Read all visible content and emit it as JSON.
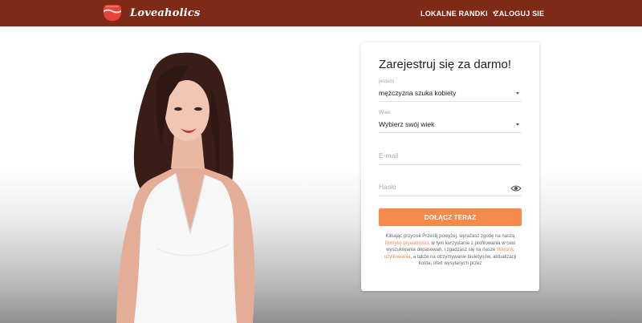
{
  "header": {
    "brand": "Loveaholics",
    "nav_local": "LOKALNE RANDKI",
    "nav_login": "ZALOGUJ SIE",
    "color": "#7e2a17"
  },
  "form": {
    "title": "Zarejestruj się za darmo!",
    "gender_label": "jestem",
    "gender_value": "mężczyzna szuka kobiety",
    "age_label": "Wiek",
    "age_value": "Wybierz swój wiek",
    "email_placeholder": "E-mail",
    "password_placeholder": "Hasło",
    "submit_label": "DOŁĄCZ TERAZ",
    "accent": "#f58a4c",
    "terms": {
      "part1": "Klikając przycisk Prześlij powyżej, wyrażasz zgodę na naszą ",
      "privacy_link": "Politykę prywatności",
      "part2": ", w tym korzystanie z profilowania w celu wyszukiwania dopasowań, i zgadzasz się na nasze ",
      "terms_link": "Warunki użytkowania",
      "part3": ", a także na otrzymywanie biuletynów, aktualizacji konta, ofert wysyłanych przez"
    }
  },
  "icons": {
    "logo": "heart-cup-logo-icon",
    "eye": "eye-icon",
    "caret": "chevron-down-icon"
  }
}
